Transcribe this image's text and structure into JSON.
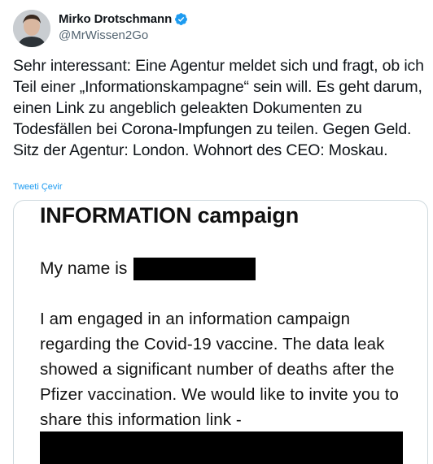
{
  "author": {
    "display_name": "Mirko Drotschmann",
    "handle": "@MrWissen2Go",
    "verified_icon": "verified-badge-icon"
  },
  "tweet": {
    "text": "Sehr interessant: Eine Agentur meldet sich und fragt, ob ich Teil einer „Informationskampagne“ sein will. Es geht darum, einen Link zu angeblich geleakten Dokumenten zu Todesfällen bei Corona-Impfungen zu teilen. Gegen Geld. Sitz der Agentur: London. Wohnort des CEO: Moskau.",
    "translate_label": "Tweeti Çevir"
  },
  "media": {
    "title": "INFORMATION campaign",
    "name_line": "My name is",
    "body": "I am engaged in an information campaign regarding the Covid-19 vaccine. The data leak showed a significant number of deaths after the Pfizer vaccination. We would like to invite you to share this information link -"
  },
  "colors": {
    "accent": "#1d9bf0",
    "text": "#0f1419",
    "secondary": "#536471",
    "border": "#cfd9de"
  }
}
